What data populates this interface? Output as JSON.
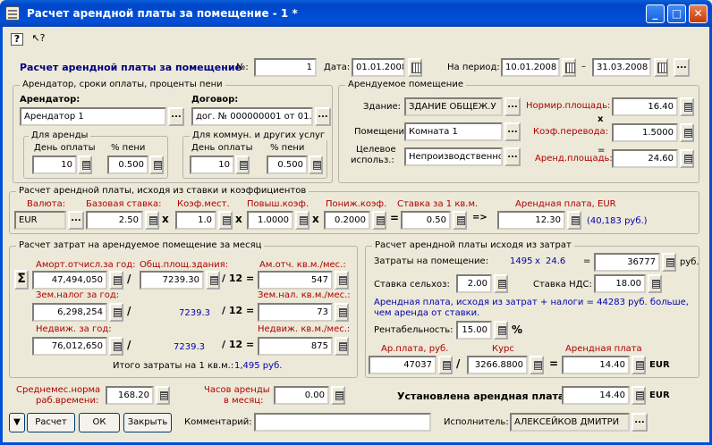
{
  "window": {
    "title": "Расчет арендной платы за помещение - 1 *"
  },
  "header": {
    "title": "Расчет арендной платы за помещение",
    "num_label": "№:",
    "num": "1",
    "date_label": "Дата:",
    "date": "01.01.2008",
    "period_label": "На период:",
    "period_from": "10.01.2008",
    "dash": "–",
    "period_to": "31.03.2008"
  },
  "tenant": {
    "group": "Арендатор, сроки оплаты, проценты пени",
    "tenant_label": "Арендатор:",
    "tenant": "Арендатор 1",
    "contract_label": "Договор:",
    "contract": "дог. № 000000001 от 01.0",
    "rent_group": "Для аренды",
    "comm_group": "Для коммун. и других услуг",
    "payday_label": "День оплаты",
    "penalty_label": "% пени",
    "rent_day": "10",
    "rent_penalty": "0.500",
    "comm_day": "10",
    "comm_penalty": "0.500"
  },
  "premises": {
    "group": "Арендуемое помещение",
    "building_label": "Здание:",
    "building": "ЗДАНИЕ ОБЩЕЖ.У",
    "room_label": "Помещение:",
    "room": "Комната 1",
    "purpose_label1": "Целевое",
    "purpose_label2": "использ.:",
    "purpose": "Непроизводственно",
    "norm_area_label": "Нормир.площадь:",
    "norm_area": "16.40",
    "x": "x",
    "coef_label": "Коэф.перевода:",
    "coef": "1.5000",
    "eq": "=",
    "rent_area_label": "Аренд.площадь:",
    "rent_area": "24.60"
  },
  "rate": {
    "group": "Расчет арендной платы, исходя из ставки и коэффициентов",
    "currency_label": "Валюта:",
    "currency": "EUR",
    "base_label": "Базовая ставка:",
    "base": "2.50",
    "loc_label": "Коэф.мест.",
    "loc": "1.0",
    "inc_label": "Повыш.коэф.",
    "inc": "1.0000",
    "dec_label": "Пониж.коэф.",
    "dec": "0.2000",
    "per_m_label": "Ставка за 1 кв.м.",
    "per_m": "0.50",
    "arrow": "=>",
    "rent_label": "Арендная плата, EUR",
    "rent": "12.30",
    "rent_rub": "(40,183 руб.)",
    "x": "x",
    "eq": "="
  },
  "costs": {
    "group": "Расчет затрат на арендуемое помещение за месяц",
    "amort_label": "Аморт.отчисл.за год:",
    "amort": "47,494,050",
    "total_area_label": "Общ.площ.здания:",
    "total_area": "7239.30",
    "amort_m_label": "Ам.отч. кв.м./мес.:",
    "amort_m": "547",
    "land_label": "Зем.налог за год:",
    "land": "6,298,254",
    "land_area": "7239.3",
    "land_m_label": "Зем.нал. кв.м./мес.:",
    "land_m": "73",
    "prop_label": "Недвиж. за год:",
    "prop": "76,012,650",
    "prop_area": "7239.3",
    "prop_m_label": "Недвиж. кв.м./мес.:",
    "prop_m": "875",
    "total_label": "Итого затраты на 1 кв.м.:",
    "total": "1,495 руб.",
    "slash": "/",
    "div12": "/ 12 =",
    "sigma": "Σ"
  },
  "costcalc": {
    "group": "Расчет арендной платы исходя из затрат",
    "exp_label": "Затраты на помещение:",
    "exp_a": "1495",
    "exp_x": "x",
    "exp_b": "24.6",
    "eq": "=",
    "exp": "36777",
    "rub": "руб.",
    "agri_label": "Ставка сельхоз:",
    "agri": "2.00",
    "vat_label": "Ставка НДС:",
    "vat": "18.00",
    "note": "Арендная плата, исходя из затрат + налоги = 44283 руб. больше, чем аренда от ставки.",
    "profit_label": "Рентабельность:",
    "profit": "15.00",
    "pct": "%",
    "rub_label": "Ар.плата, руб.",
    "rub_value": "47037",
    "rate_label": "Курс",
    "rate": "3266.8800",
    "result_label": "Арендная плата",
    "result": "14.40",
    "cur": "EUR",
    "slash": "/"
  },
  "hours": {
    "norm_label1": "Среднемес.норма",
    "norm_label2": "раб.времени:",
    "norm": "168.20",
    "rent_label1": "Часов аренды",
    "rent_label2": "в месяц:",
    "rent": "0.00"
  },
  "final": {
    "label": "Установлена арендная плата:",
    "value": "14.40",
    "cur": "EUR"
  },
  "footer": {
    "calc": "Расчет",
    "ok": "ОК",
    "close": "Закрыть",
    "comment_label": "Комментарий:",
    "comment": "",
    "exec_label": "Исполнитель:",
    "exec": "АЛЕКСЕЙКОВ ДМИТРИ",
    "menu": "▼"
  },
  "toolbar": {
    "help": "?",
    "whatsthis": "↖?"
  },
  "colors": {
    "title": "#0050d8",
    "red": "#b00000",
    "blue": "#0000b0",
    "navy": "#00007f"
  }
}
